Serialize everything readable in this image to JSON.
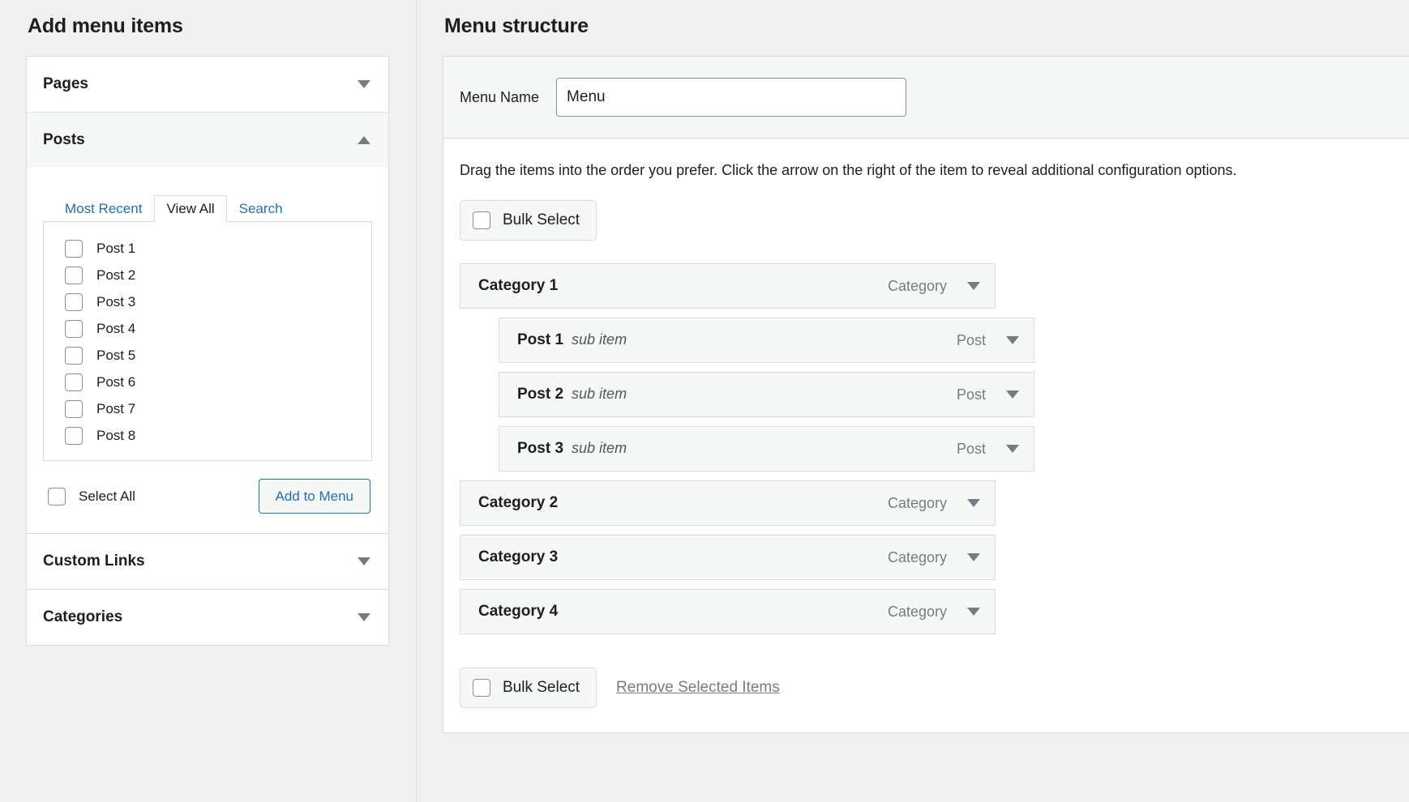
{
  "left_panel": {
    "title": "Add menu items",
    "sections": [
      {
        "id": "pages",
        "label": "Pages",
        "state": "collapsed",
        "caret_icon": "chevron-down-icon"
      },
      {
        "id": "posts",
        "label": "Posts",
        "state": "expanded",
        "caret_icon": "chevron-up-icon"
      },
      {
        "id": "custom-links",
        "label": "Custom Links",
        "state": "collapsed",
        "caret_icon": "chevron-down-icon"
      },
      {
        "id": "categories",
        "label": "Categories",
        "state": "collapsed",
        "caret_icon": "chevron-down-icon"
      }
    ],
    "posts_panel": {
      "tabs": [
        {
          "label": "Most Recent",
          "active": false
        },
        {
          "label": "View All",
          "active": true
        },
        {
          "label": "Search",
          "active": false
        }
      ],
      "items": [
        {
          "label": "Post 1",
          "checked": false
        },
        {
          "label": "Post 2",
          "checked": false
        },
        {
          "label": "Post 3",
          "checked": false
        },
        {
          "label": "Post 4",
          "checked": false
        },
        {
          "label": "Post 5",
          "checked": false
        },
        {
          "label": "Post 6",
          "checked": false
        },
        {
          "label": "Post 7",
          "checked": false
        },
        {
          "label": "Post 8",
          "checked": false
        }
      ],
      "select_all_label": "Select All",
      "select_all_checked": false,
      "add_button_label": "Add to Menu"
    }
  },
  "right_panel": {
    "title": "Menu structure",
    "menu_name_label": "Menu Name",
    "menu_name_value": "Menu",
    "menu_name_placeholder": "Menu Name",
    "hint": "Drag the items into the order you prefer. Click the arrow on the right of the item to reveal additional configuration options.",
    "bulk_select_top_label": "Bulk Select",
    "bulk_select_top_checked": false,
    "bulk_select_bottom_label": "Bulk Select",
    "bulk_select_bottom_checked": false,
    "remove_selected_label": "Remove Selected Items",
    "menu_items": [
      {
        "title": "Category 1",
        "sub": "",
        "type": "Category",
        "depth": 0,
        "caret_icon": "chevron-down-icon"
      },
      {
        "title": "Post 1",
        "sub": "sub item",
        "type": "Post",
        "depth": 1,
        "caret_icon": "chevron-down-icon"
      },
      {
        "title": "Post 2",
        "sub": "sub item",
        "type": "Post",
        "depth": 1,
        "caret_icon": "chevron-down-icon"
      },
      {
        "title": "Post 3",
        "sub": "sub item",
        "type": "Post",
        "depth": 1,
        "caret_icon": "chevron-down-icon"
      },
      {
        "title": "Category 2",
        "sub": "",
        "type": "Category",
        "depth": 0,
        "caret_icon": "chevron-down-icon"
      },
      {
        "title": "Category 3",
        "sub": "",
        "type": "Category",
        "depth": 0,
        "caret_icon": "chevron-down-icon"
      },
      {
        "title": "Category 4",
        "sub": "",
        "type": "Category",
        "depth": 0,
        "caret_icon": "chevron-down-icon"
      }
    ]
  },
  "colors": {
    "page_background": "#f0f0f0",
    "panel_background": "#ffffff",
    "row_background": "#f6f7f7",
    "border": "#dcdcde",
    "link": "#2271b1",
    "text": "#1e1e1e",
    "muted_text": "#787c82"
  }
}
